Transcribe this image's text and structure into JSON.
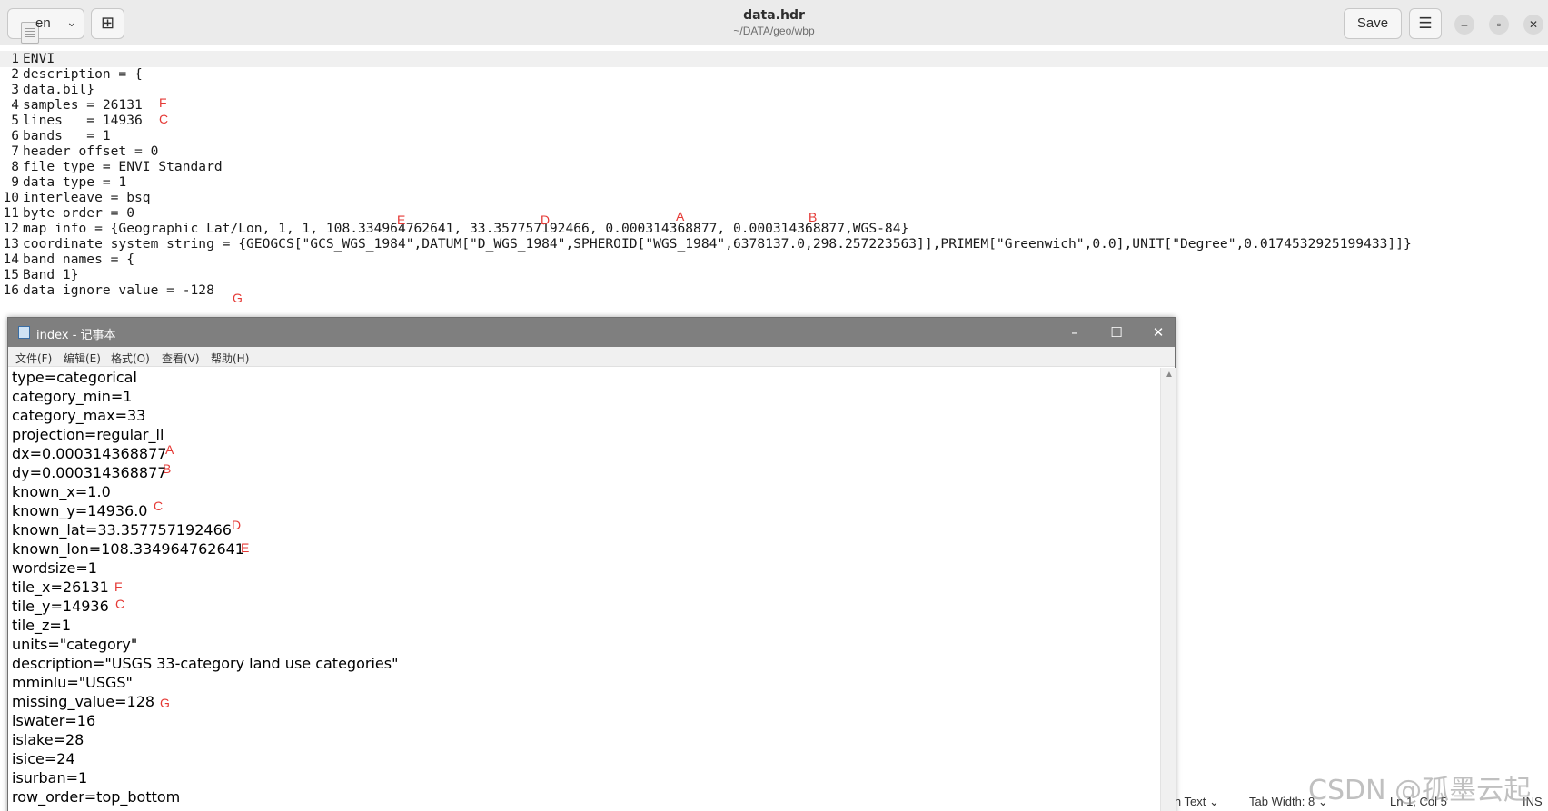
{
  "header": {
    "open_label": "en",
    "file_title": "data.hdr",
    "file_path": "~/DATA/geo/wbp",
    "save_label": "Save",
    "menu_icon": "hamburger-icon",
    "minimize_icon": "minimize-icon",
    "maximize_icon": "restore-icon",
    "close_icon": "close-icon"
  },
  "editor": {
    "lines": [
      {
        "num": "1",
        "text": "ENVI"
      },
      {
        "num": "2",
        "text": "description = {"
      },
      {
        "num": "3",
        "text": "data.bil}"
      },
      {
        "num": "4",
        "text": "samples = 26131"
      },
      {
        "num": "5",
        "text": "lines   = 14936"
      },
      {
        "num": "6",
        "text": "bands   = 1"
      },
      {
        "num": "7",
        "text": "header offset = 0"
      },
      {
        "num": "8",
        "text": "file type = ENVI Standard"
      },
      {
        "num": "9",
        "text": "data type = 1"
      },
      {
        "num": "10",
        "text": "interleave = bsq"
      },
      {
        "num": "11",
        "text": "byte order = 0"
      },
      {
        "num": "12",
        "text": "map info = {Geographic Lat/Lon, 1, 1, 108.334964762641, 33.357757192466, 0.000314368877, 0.000314368877,WGS-84}"
      },
      {
        "num": "13",
        "text": "coordinate system string = {GEOGCS[\"GCS_WGS_1984\",DATUM[\"D_WGS_1984\",SPHEROID[\"WGS_1984\",6378137.0,298.257223563]],PRIMEM[\"Greenwich\",0.0],UNIT[\"Degree\",0.0174532925199433]]}"
      },
      {
        "num": "14",
        "text": "band names = {"
      },
      {
        "num": "15",
        "text": "Band 1}"
      },
      {
        "num": "16",
        "text": "data ignore value = -128"
      }
    ],
    "annotations": [
      "F",
      "C",
      "E",
      "D",
      "A",
      "B",
      "G"
    ]
  },
  "status": {
    "lang": "in Text",
    "tab_width": "Tab Width: 8",
    "position": "Ln 1, Col 5",
    "mode": "INS"
  },
  "notepad": {
    "title": "index - 记事本",
    "menu": [
      "文件(F)",
      "编辑(E)",
      "格式(O)",
      "查看(V)",
      "帮助(H)"
    ],
    "lines": [
      "type=categorical",
      "category_min=1",
      "category_max=33",
      "projection=regular_ll",
      "dx=0.000314368877",
      "dy=0.000314368877",
      "known_x=1.0",
      "known_y=14936.0",
      "known_lat=33.357757192466",
      "known_lon=108.334964762641",
      "wordsize=1",
      "tile_x=26131",
      "tile_y=14936",
      "tile_z=1",
      "units=\"category\"",
      "description=\"USGS 33-category land use categories\"",
      "mminlu=\"USGS\"",
      "missing_value=128",
      "iswater=16",
      "islake=28",
      "isice=24",
      "isurban=1",
      "row_order=top_bottom"
    ],
    "annotations": [
      "A",
      "B",
      "C",
      "D",
      "E",
      "F",
      "C",
      "G"
    ]
  },
  "watermark": "CSDN @孤墨云起"
}
